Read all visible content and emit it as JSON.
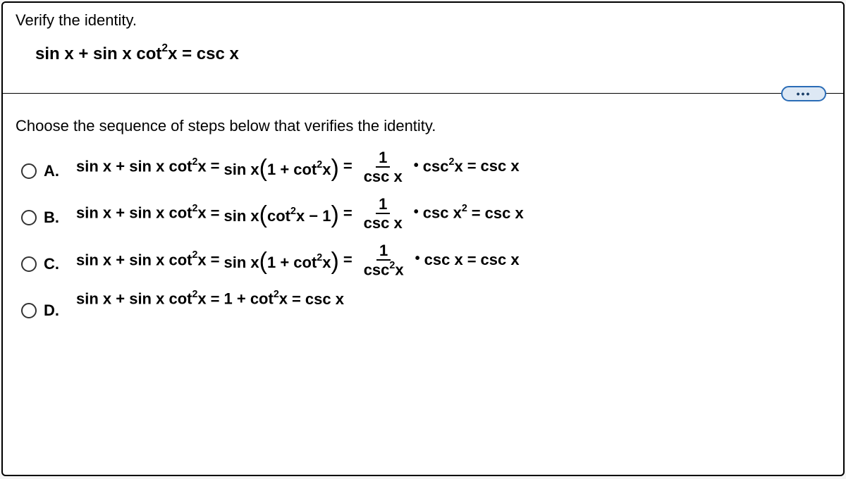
{
  "question": {
    "prompt": "Verify the identity.",
    "identity": "sin x + sin x cot²x = csc x",
    "subprompt": "Choose the sequence of steps below that verifies the identity."
  },
  "options": [
    {
      "label": "A.",
      "math_aria": "sin x + sin x cot²x = sin x (1 + cot²x) = (1 / csc x) · csc²x = csc x"
    },
    {
      "label": "B.",
      "math_aria": "sin x + sin x cot²x = sin x (cot²x − 1) = (1 / csc x) · csc x² = csc x"
    },
    {
      "label": "C.",
      "math_aria": "sin x + sin x cot²x = sin x (1 + cot²x) = (1 / csc²x) · csc x = csc x"
    },
    {
      "label": "D.",
      "math_aria": "sin x + sin x cot²x = 1 + cot²x = csc x"
    }
  ],
  "ui": {
    "more_button_label": "More options"
  }
}
